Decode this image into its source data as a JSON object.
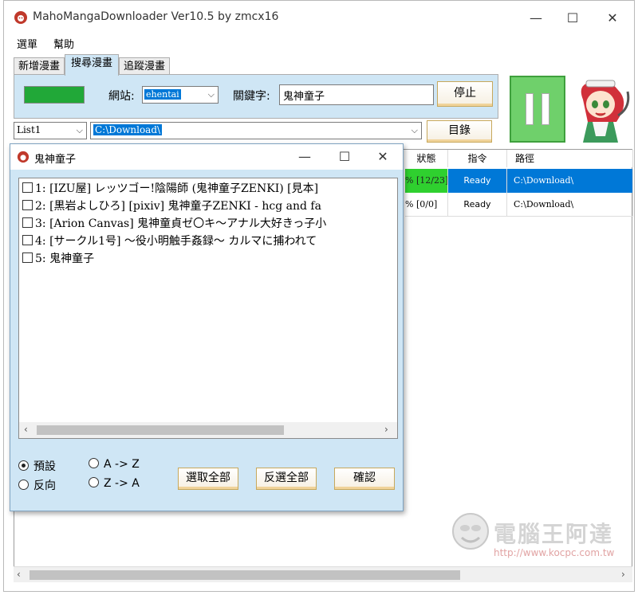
{
  "app": {
    "title": "MahoMangaDownloader Ver10.5 by zmcx16",
    "min_glyph": "—",
    "max_glyph": "☐",
    "close_glyph": "✕"
  },
  "menu": [
    "選單",
    "幫助"
  ],
  "tabs": [
    "新增漫畫",
    "搜尋漫畫",
    "追蹤漫畫"
  ],
  "search_panel": {
    "site_label": "網站:",
    "site_value": "ehentai",
    "keyword_label": "關鍵字:",
    "keyword_value": "鬼神童子",
    "stop_label": "停止"
  },
  "list_select": {
    "value": "List1"
  },
  "path_select": {
    "value": "C:\\Download\\"
  },
  "dir_button": "目錄",
  "grid": {
    "headers": {
      "status": "狀態",
      "command": "指令",
      "path": "路徑"
    },
    "rows": [
      {
        "status": "% [12/23]",
        "command": "Ready",
        "path": "C:\\Download\\"
      },
      {
        "status": "% [0/0]",
        "command": "Ready",
        "path": "C:\\Download\\"
      }
    ]
  },
  "dialog": {
    "title": "鬼神童子",
    "items": [
      "1: [IZU屋] レッツゴー!陰陽師 (鬼神童子ZENKI) [見本]",
      "2: [黒岩よしひろ] [pixiv] 鬼神童子ZENKI - hcg and fa",
      "3: [Arion Canvas] 鬼神童貞ゼ〇キ～アナル大好きっ子小",
      "4: [サークル1号] ～役小明触手姦録～ カルマに捕われて",
      "5: 鬼神童子"
    ],
    "sort_options": {
      "default": "預設",
      "reverse": "反向",
      "az": "A -> Z",
      "za": "Z -> A"
    },
    "select_all": "選取全部",
    "invert_select": "反選全部",
    "confirm": "確認"
  },
  "watermark": {
    "text": "電腦王阿達",
    "url": "http://www.kocpc.com.tw"
  },
  "colors": {
    "panel_blue": "#cfe6f5",
    "progress_green": "#21a838",
    "pause_green": "#6fd06b",
    "selection_blue": "#0078d7",
    "button_gold": "#f0d39a"
  }
}
